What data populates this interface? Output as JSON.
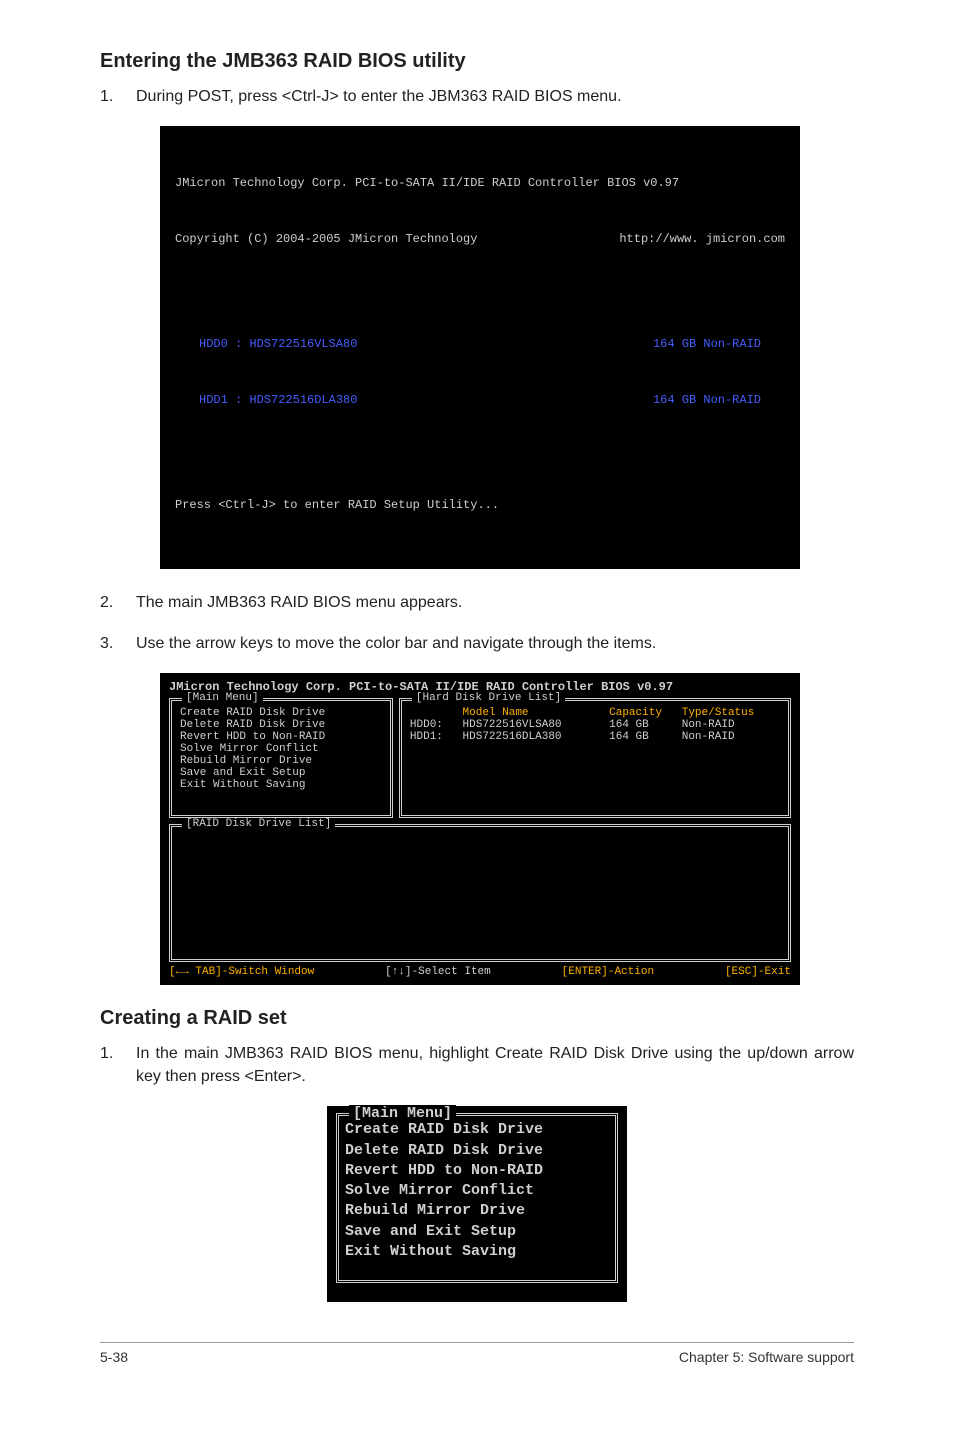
{
  "section1": {
    "heading": "Entering the JMB363 RAID BIOS utility",
    "step1_num": "1.",
    "step1_text": "During POST, press <Ctrl-J> to enter the JBM363 RAID BIOS menu.",
    "step2_num": "2.",
    "step2_text": "The main JMB363 RAID BIOS menu appears.",
    "step3_num": "3.",
    "step3_text": "Use the arrow keys to move the color bar and navigate through the items."
  },
  "bios1": {
    "line1": "JMicron Technology Corp. PCI-to-SATA II/IDE RAID Controller BIOS v0.97",
    "line2_left": "Copyright (C) 2004-2005 JMicron Technology",
    "line2_right": "http://www. jmicron.com",
    "drive1_left": "HDD0 : HDS722516VLSA80",
    "drive1_right": "164 GB Non-RAID",
    "drive2_left": "HDD1 : HDS722516DLA380",
    "drive2_right": "164 GB Non-RAID",
    "prompt": "Press <Ctrl-J> to enter RAID Setup Utility..."
  },
  "bios2": {
    "title": "JMicron Technology Corp. PCI-to-SATA II/IDE RAID Controller BIOS v0.97",
    "main_menu_label": "[Main Menu]",
    "hdd_list_label": "[Hard Disk Drive List]",
    "raid_list_label": "[RAID Disk Drive List]",
    "menu_items": [
      "Create RAID Disk Drive",
      "Delete RAID Disk Drive",
      "Revert HDD to Non-RAID",
      "Solve Mirror Conflict",
      "Rebuild Mirror Drive",
      "Save and Exit Setup",
      "Exit Without Saving"
    ],
    "hdd_header": {
      "model": "Model Name",
      "cap": "Capacity",
      "stat": "Type/Status"
    },
    "hdd_rows": [
      {
        "label": "HDD0:",
        "model": "HDS722516VLSA80",
        "cap": "164 GB",
        "stat": "Non-RAID"
      },
      {
        "label": "HDD1:",
        "model": "HDS722516DLA380",
        "cap": "164 GB",
        "stat": "Non-RAID"
      }
    ],
    "footer": {
      "switch": "[←→ TAB]-Switch Window",
      "select": "[↑↓]-Select Item",
      "action": "[ENTER]-Action",
      "exit": "[ESC]-Exit"
    }
  },
  "section2": {
    "heading": "Creating a RAID set",
    "step1_num": "1.",
    "step1_text": "In the main JMB363 RAID BIOS menu, highlight Create RAID Disk Drive using the up/down arrow key then press <Enter>."
  },
  "menu_closeup": {
    "legend": "[Main Menu]",
    "items": [
      "Create RAID Disk Drive",
      "Delete RAID Disk Drive",
      "Revert HDD to Non-RAID",
      "Solve Mirror Conflict",
      "Rebuild Mirror Drive",
      "Save and Exit Setup",
      "Exit Without Saving"
    ]
  },
  "footer": {
    "left": "5-38",
    "right": "Chapter 5: Software support"
  }
}
